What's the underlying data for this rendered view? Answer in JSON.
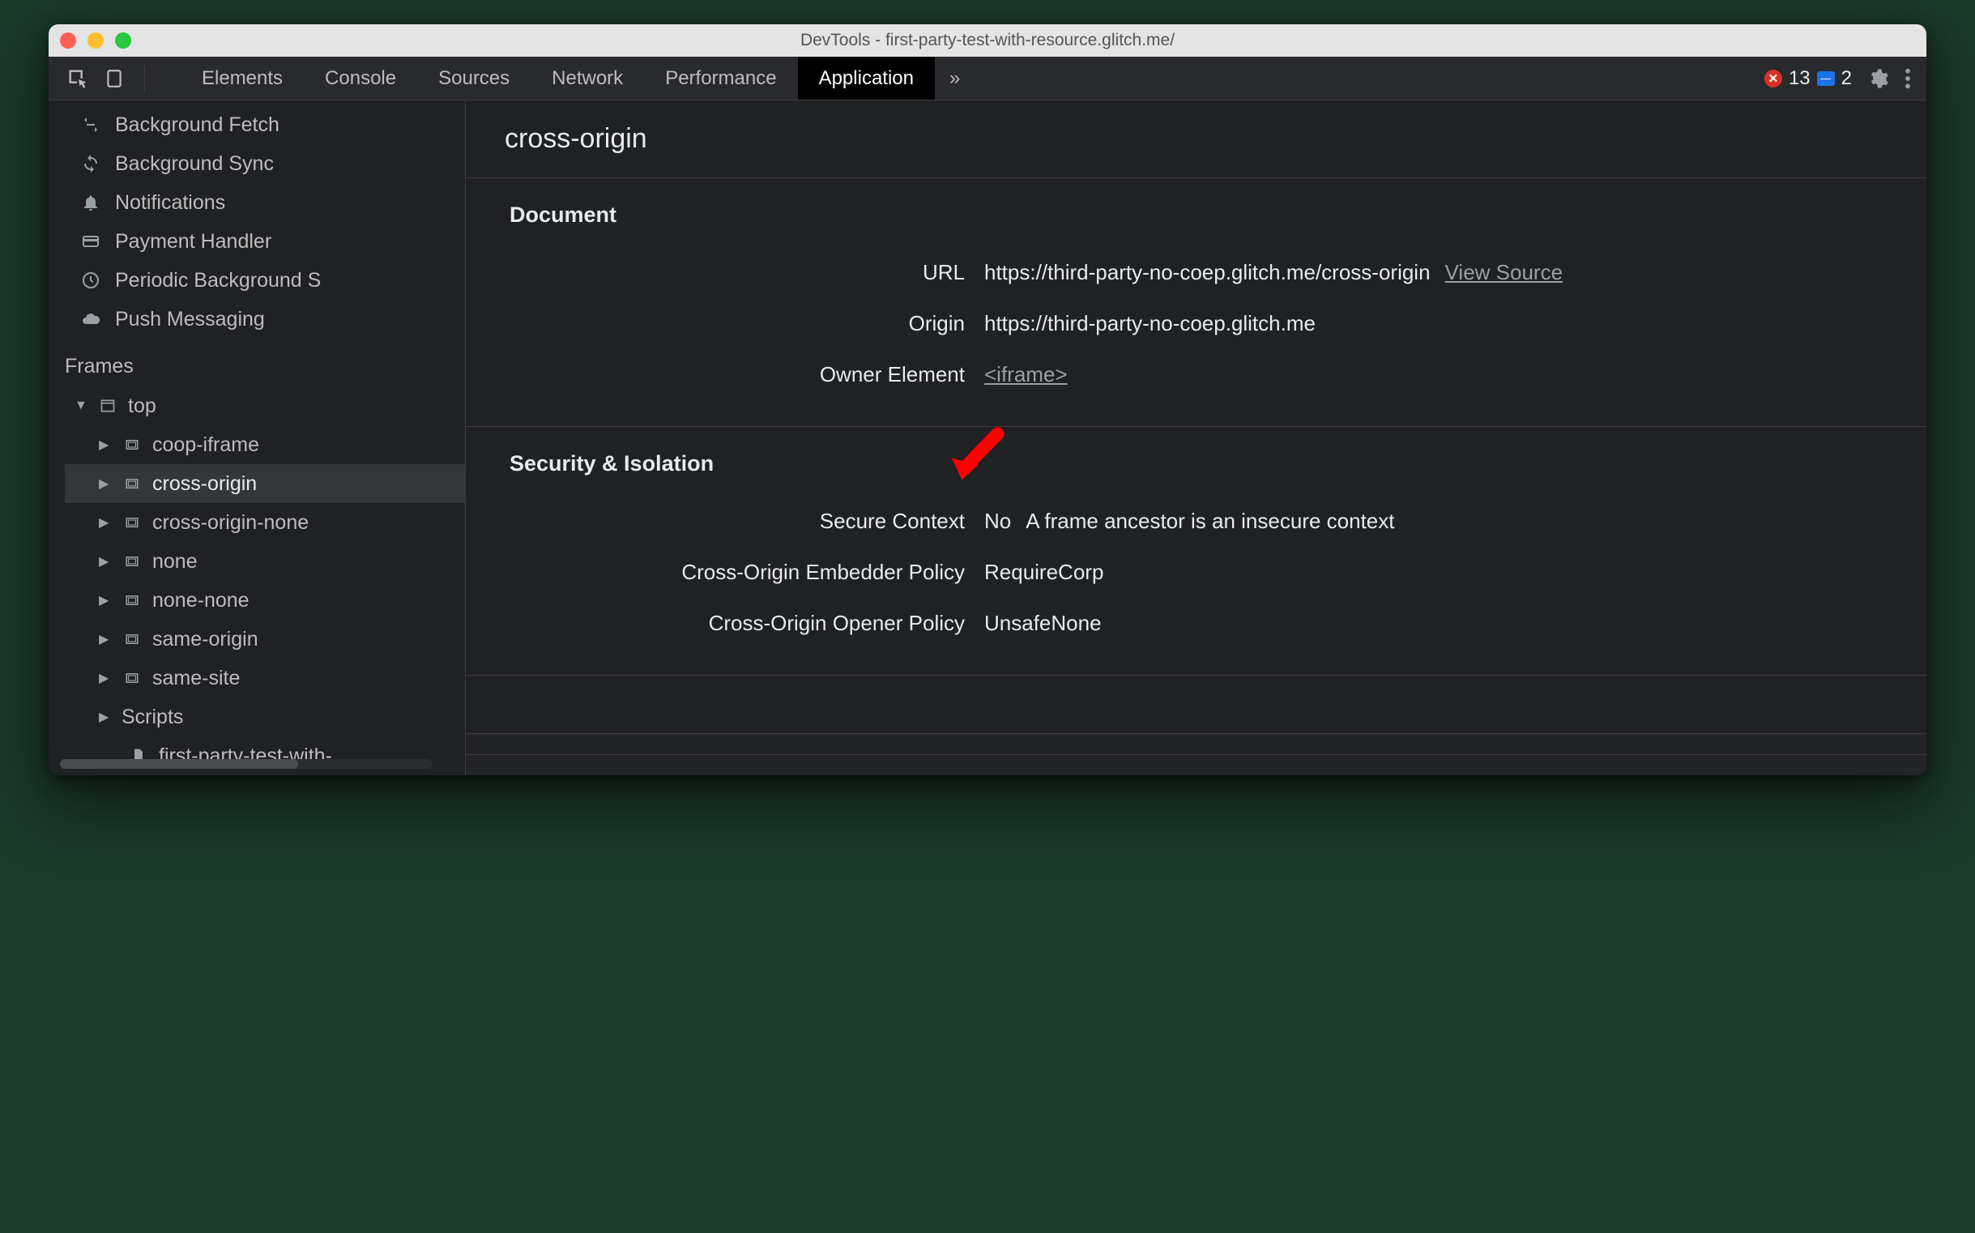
{
  "window": {
    "title": "DevTools - first-party-test-with-resource.glitch.me/"
  },
  "toolbar": {
    "tabs": [
      "Elements",
      "Console",
      "Sources",
      "Network",
      "Performance",
      "Application"
    ],
    "active_tab": "Application",
    "more_label": "»",
    "errors_count": "13",
    "messages_count": "2"
  },
  "sidebar": {
    "bg_items": [
      {
        "icon": "fetch-icon",
        "label": "Background Fetch"
      },
      {
        "icon": "sync-icon",
        "label": "Background Sync"
      },
      {
        "icon": "bell-icon",
        "label": "Notifications"
      },
      {
        "icon": "card-icon",
        "label": "Payment Handler"
      },
      {
        "icon": "clock-icon",
        "label": "Periodic Background S"
      },
      {
        "icon": "cloud-icon",
        "label": "Push Messaging"
      }
    ],
    "frames_header": "Frames",
    "frames": {
      "top_label": "top",
      "children": [
        "coop-iframe",
        "cross-origin",
        "cross-origin-none",
        "none",
        "none-none",
        "same-origin",
        "same-site"
      ],
      "selected": "cross-origin",
      "scripts_label": "Scripts",
      "script_file": "first-party-test-with-"
    }
  },
  "content": {
    "title": "cross-origin",
    "document": {
      "heading": "Document",
      "url_label": "URL",
      "url_value": "https://third-party-no-coep.glitch.me/cross-origin",
      "view_source": "View Source",
      "origin_label": "Origin",
      "origin_value": "https://third-party-no-coep.glitch.me",
      "owner_label": "Owner Element",
      "owner_value": "<iframe>"
    },
    "security": {
      "heading": "Security & Isolation",
      "secure_label": "Secure Context",
      "secure_value": "No",
      "secure_note": "A frame ancestor is an insecure context",
      "coep_label": "Cross-Origin Embedder Policy",
      "coep_value": "RequireCorp",
      "coop_label": "Cross-Origin Opener Policy",
      "coop_value": "UnsafeNone"
    }
  },
  "annotation": {
    "arrow_color": "#ff0000"
  }
}
